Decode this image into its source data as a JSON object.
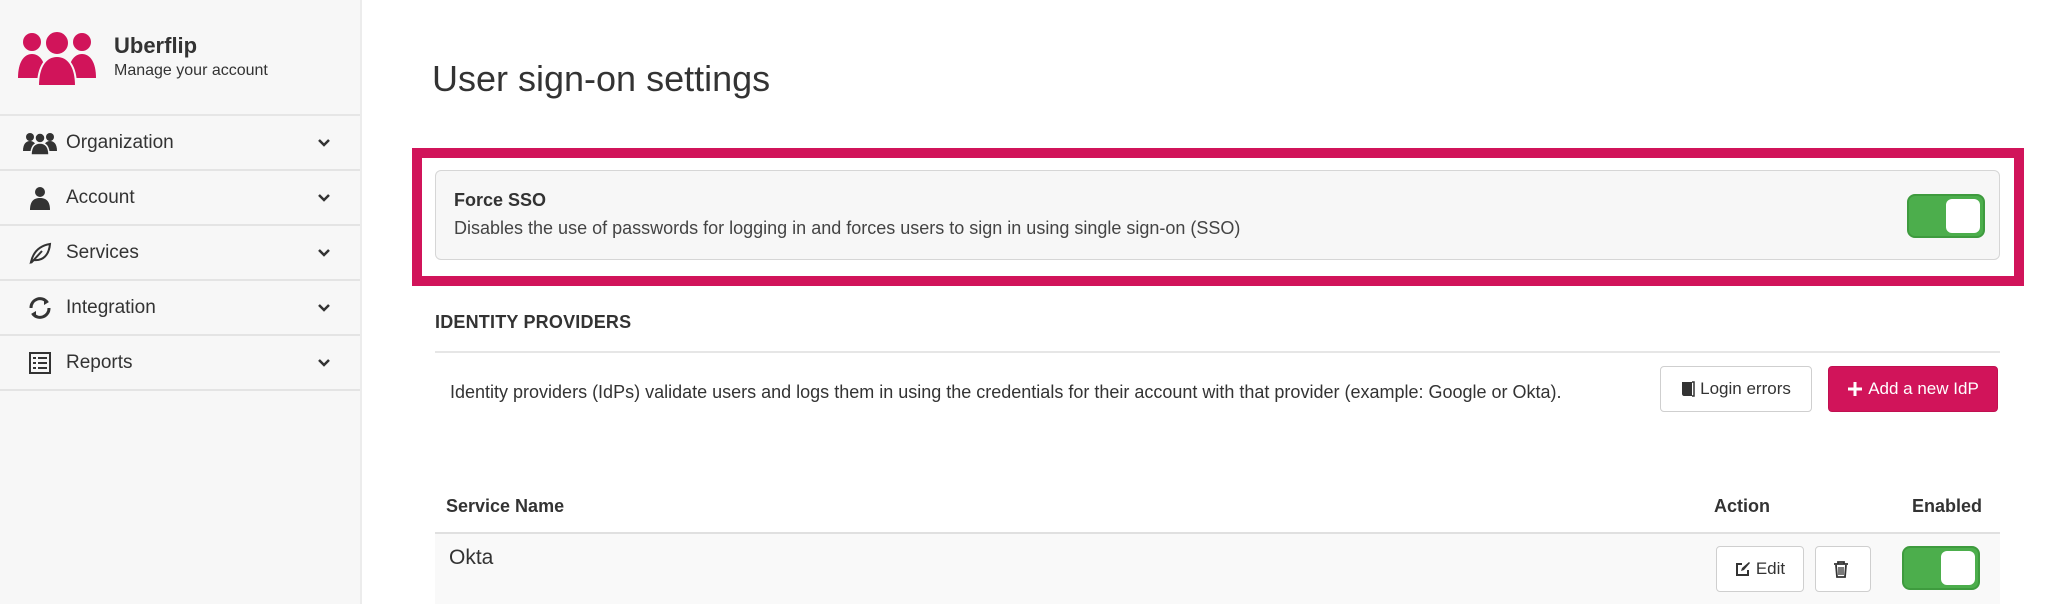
{
  "brand": {
    "name": "Uberflip",
    "subtitle": "Manage your account",
    "color": "#d1145a"
  },
  "sidebar": {
    "items": [
      {
        "label": "Organization",
        "icon": "users-icon"
      },
      {
        "label": "Account",
        "icon": "user-icon"
      },
      {
        "label": "Services",
        "icon": "leaf-icon"
      },
      {
        "label": "Integration",
        "icon": "sync-icon"
      },
      {
        "label": "Reports",
        "icon": "list-icon"
      }
    ]
  },
  "page": {
    "title": "User sign-on settings"
  },
  "force_sso": {
    "title": "Force SSO",
    "description": "Disables the use of passwords for logging in and forces users to sign in using single sign-on (SSO)",
    "enabled": true
  },
  "identity_providers": {
    "header": "IDENTITY PROVIDERS",
    "description": "Identity providers (IdPs) validate users and logs them in using the credentials for their account with that provider (example: Google or Okta).",
    "login_errors_label": "Login errors",
    "add_label": "Add a new IdP",
    "columns": {
      "service": "Service Name",
      "action": "Action",
      "enabled": "Enabled"
    },
    "rows": [
      {
        "name": "Okta",
        "edit_label": "Edit",
        "enabled": true
      }
    ]
  },
  "colors": {
    "accent": "#d1145a",
    "toggle_on": "#4cae4c"
  }
}
